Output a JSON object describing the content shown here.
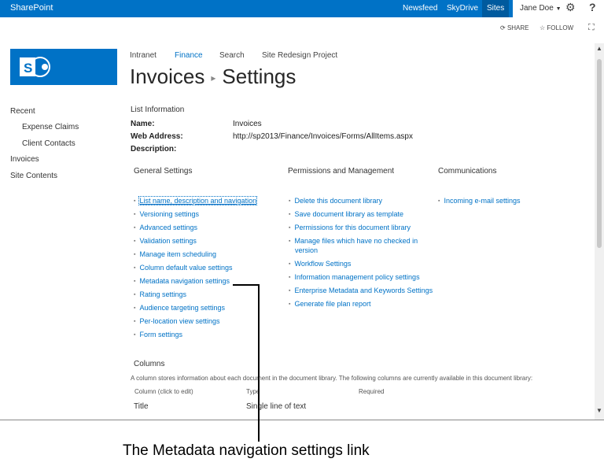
{
  "suite_bar": {
    "brand": "SharePoint",
    "links": [
      "Newsfeed",
      "SkyDrive",
      "Sites"
    ],
    "user": "Jane Doe",
    "help": "?"
  },
  "ribbon": {
    "share": "SHARE",
    "follow": "FOLLOW"
  },
  "global_nav": [
    "Intranet",
    "Finance",
    "Search",
    "Site Redesign Project"
  ],
  "page_title": {
    "list": "Invoices",
    "page": "Settings"
  },
  "left_nav": [
    "Recent",
    "Expense Claims",
    "Client Contacts",
    "Invoices",
    "Site Contents"
  ],
  "list_info": {
    "heading": "List Information",
    "name_label": "Name:",
    "name_value": "Invoices",
    "address_label": "Web Address:",
    "address_value": "http://sp2013/Finance/Invoices/Forms/AllItems.aspx",
    "description_label": "Description:"
  },
  "general": {
    "heading": "General Settings",
    "links": [
      "List name, description and navigation",
      "Versioning settings",
      "Advanced settings",
      "Validation settings",
      "Manage item scheduling",
      "Column default value settings",
      "Metadata navigation settings",
      "Rating settings",
      "Audience targeting settings",
      "Per-location view settings",
      "Form settings"
    ]
  },
  "permissions": {
    "heading": "Permissions and Management",
    "links": [
      "Delete this document library",
      "Save document library as template",
      "Permissions for this document library",
      "Manage files which have no checked in",
      "version",
      "Workflow Settings",
      "Information management policy settings",
      "Enterprise Metadata and Keywords Settings",
      "Generate file plan report"
    ]
  },
  "communications": {
    "heading": "Communications",
    "links": [
      "Incoming e-mail settings"
    ]
  },
  "columns": {
    "heading": "Columns",
    "description": "A column stores information about each document in the document library. The following columns are currently available in this document library:",
    "headers": [
      "Column (click to edit)",
      "Type",
      "Required"
    ],
    "rows": [
      [
        "Title",
        "Single line of text"
      ]
    ]
  },
  "caption": "The Metadata navigation settings link",
  "colors": {
    "accent": "#0072c6",
    "suite_bar": "#0072c6",
    "sites_active": "#005a9e"
  }
}
